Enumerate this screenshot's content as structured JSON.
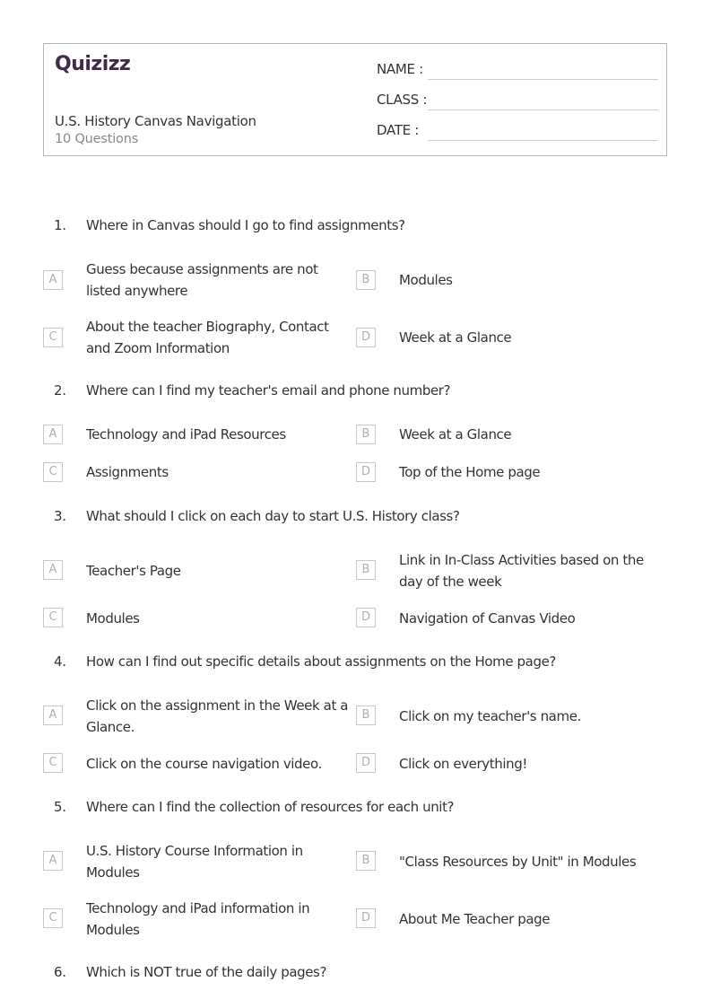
{
  "header": {
    "logo": "Quizizz",
    "title": "U.S. History Canvas Navigation",
    "count": "10 Questions",
    "fields": [
      {
        "label": "NAME :"
      },
      {
        "label": "CLASS :"
      },
      {
        "label": "DATE  :"
      }
    ]
  },
  "questions": [
    {
      "number": "1.",
      "text": "Where in Canvas should I go to find assignments?",
      "options": [
        {
          "letter": "A",
          "text": "Guess because assignments are not listed anywhere"
        },
        {
          "letter": "B",
          "text": "Modules"
        },
        {
          "letter": "C",
          "text": "About the teacher Biography, Contact and Zoom Information"
        },
        {
          "letter": "D",
          "text": "Week at a Glance"
        }
      ]
    },
    {
      "number": "2.",
      "text": "Where can I find my teacher's email and phone number?",
      "options": [
        {
          "letter": "A",
          "text": "Technology and iPad Resources"
        },
        {
          "letter": "B",
          "text": "Week at a Glance"
        },
        {
          "letter": "C",
          "text": "Assignments"
        },
        {
          "letter": "D",
          "text": "Top of the Home page"
        }
      ]
    },
    {
      "number": "3.",
      "text": "What should I click on each day to start U.S. History class?",
      "options": [
        {
          "letter": "A",
          "text": "Teacher's Page"
        },
        {
          "letter": "B",
          "text": "Link in In-Class Activities based on the day of the week"
        },
        {
          "letter": "C",
          "text": "Modules"
        },
        {
          "letter": "D",
          "text": "Navigation of Canvas Video"
        }
      ]
    },
    {
      "number": "4.",
      "text": "How can I find out specific details about assignments on the Home page?",
      "options": [
        {
          "letter": "A",
          "text": "Click on the assignment in the Week at a Glance."
        },
        {
          "letter": "B",
          "text": "Click on my teacher's name."
        },
        {
          "letter": "C",
          "text": "Click on the course navigation video."
        },
        {
          "letter": "D",
          "text": "Click on everything!"
        }
      ]
    },
    {
      "number": "5.",
      "text": "Where can I find the collection of resources for each unit?",
      "options": [
        {
          "letter": "A",
          "text": "U.S. History Course Information in Modules"
        },
        {
          "letter": "B",
          "text": "\"Class Resources by Unit\" in Modules"
        },
        {
          "letter": "C",
          "text": "Technology and iPad information in Modules"
        },
        {
          "letter": "D",
          "text": "About Me Teacher page"
        }
      ]
    },
    {
      "number": "6.",
      "text": "Which is NOT true of the daily pages?",
      "options": []
    }
  ]
}
